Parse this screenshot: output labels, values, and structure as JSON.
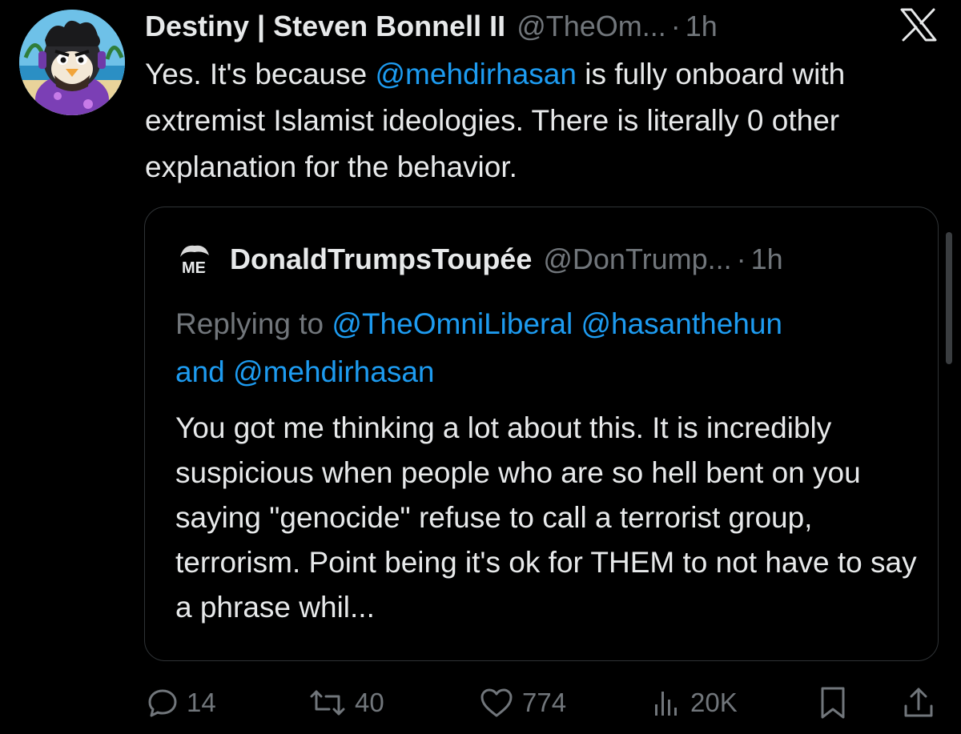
{
  "tweet": {
    "author": {
      "display_name": "Destiny | Steven Bonnell II",
      "handle": "@TheOm...",
      "avatar": "cartoon-penguin-avatar"
    },
    "separator": "·",
    "time": "1h",
    "platform_logo": "x-logo",
    "text": {
      "part1": "Yes. It's because ",
      "mention": "@mehdirhasan",
      "part2": " is fully onboard with extremist Islamist ideologies. There is literally 0 other explanation for the behavior."
    }
  },
  "quote": {
    "author": {
      "display_name": "DonaldTrumpsToupée",
      "handle": "@DonTrump...",
      "avatar": "toupee-avatar",
      "avatar_text": "ME"
    },
    "separator": "·",
    "time": "1h",
    "replying_prefix": "Replying to ",
    "mention1": "@TheOmniLiberal",
    "mention2": "@hasanthehun",
    "and_text": "and ",
    "mention3": "@mehdirhasan",
    "text": "You got me thinking a lot about this. It is incredibly suspicious when people who are so hell bent on you saying \"genocide\" refuse to call a terrorist group, terrorism. Point being it's ok for THEM to not have to say a phrase whil..."
  },
  "actions": {
    "replies": {
      "icon": "reply-icon",
      "count": "14"
    },
    "reposts": {
      "icon": "repost-icon",
      "count": "40"
    },
    "likes": {
      "icon": "heart-icon",
      "count": "774"
    },
    "views": {
      "icon": "analytics-icon",
      "count": "20K"
    },
    "bookmark": {
      "icon": "bookmark-icon"
    },
    "share": {
      "icon": "share-icon"
    }
  },
  "colors": {
    "background": "#000000",
    "text": "#e7e9ea",
    "secondary": "#71767b",
    "link": "#1d9bf0",
    "border": "#2f3336"
  }
}
